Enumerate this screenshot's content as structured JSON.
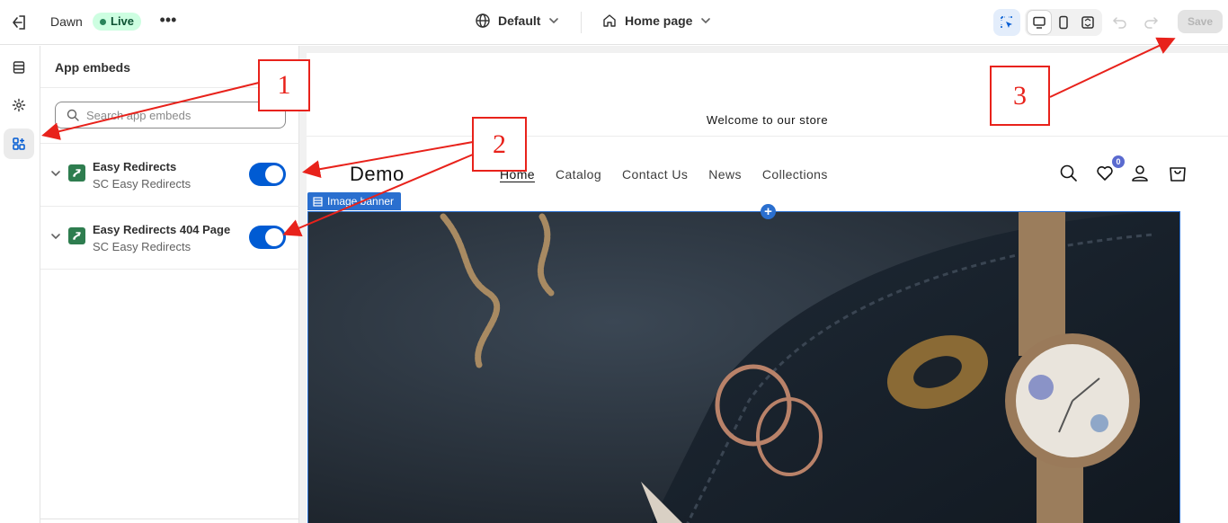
{
  "topbar": {
    "theme_name": "Dawn",
    "status": "Live",
    "more": "•••",
    "template_selector": "Default",
    "page_selector": "Home page",
    "save_label": "Save"
  },
  "panel": {
    "title": "App embeds",
    "search_placeholder": "Search app embeds",
    "embeds": [
      {
        "name": "Easy Redirects",
        "provider": "SC Easy Redirects",
        "enabled": true
      },
      {
        "name": "Easy Redirects 404 Page",
        "provider": "SC Easy Redirects",
        "enabled": true
      }
    ]
  },
  "store": {
    "announcement": "Welcome to our store",
    "brand": "Demo",
    "nav": [
      "Home",
      "Catalog",
      "Contact Us",
      "News",
      "Collections"
    ],
    "wishlist_count": "0",
    "section_label": "Image banner"
  },
  "annotations": [
    "1",
    "2",
    "3"
  ],
  "colors": {
    "accent": "#005bd3",
    "annotation": "#e8221b",
    "live_bg": "#cdfee1"
  }
}
